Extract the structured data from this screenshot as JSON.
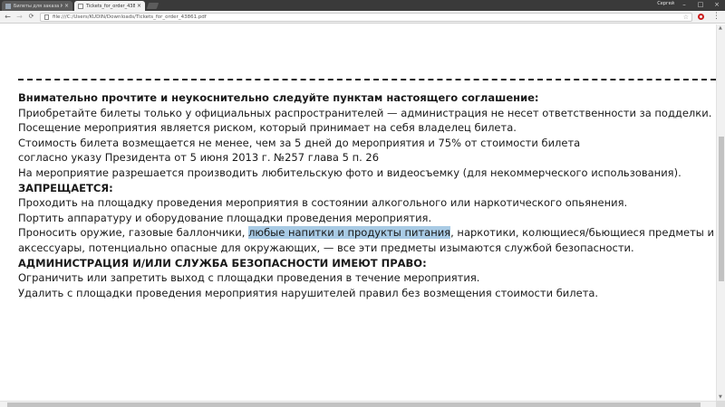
{
  "browser": {
    "tabs": [
      {
        "label": "Билеты для заказа №43861",
        "close": "×"
      },
      {
        "label": "Tickets_for_order_43861.pdf",
        "close": "×"
      }
    ],
    "user": "Сергей",
    "window_controls": {
      "minimize": "–",
      "maximize": "□",
      "close": "×"
    },
    "nav": {
      "back": "←",
      "forward": "→",
      "reload": "⟳"
    },
    "url": "file:///C:/Users/KUDIN/Downloads/Tickets_for_order_43861.pdf",
    "star": "☆",
    "menu": "⋮"
  },
  "document": {
    "heading": "Внимательно прочтите и неукоснительно следуйте пунктам настоящего соглашение:",
    "lines": [
      "Приобретайте билеты только у официальных распространителей — администрация не несет ответственности за подделки.",
      "Посещение мероприятия является риском, который принимает на себя владелец билета.",
      "Стоимость билета возмещается не менее, чем за 5 дней до мероприятия и 75% от стоимости билета",
      "согласно указу Президента от 5 июня 2013 г. №257 глава 5 п. 26",
      "На мероприятие разрешается производить любительскую фото и видеосъемку (для некоммерческого использования)."
    ],
    "forbidden_heading": "ЗАПРЕЩАЕТСЯ:",
    "forbidden_lines": [
      "Проходить на площадку проведения мероприятия в состоянии алкогольного или наркотического опьянения.",
      "Портить аппаратуру и оборудование площадки проведения мероприятия."
    ],
    "weapons_line": {
      "before": "Проносить оружие, газовые баллончики, ",
      "highlight": "любые напитки и продукты питания",
      "after": ", наркотики, колющиеся/бьющиеся предметы и"
    },
    "weapons_line2": "аксессуары, потенциально опасные для окружающих, — все эти предметы изымаются службой безопасности.",
    "admin_heading": "АДМИНИСТРАЦИЯ И/ИЛИ СЛУЖБА БЕЗОПАСНОСТИ ИМЕЮТ ПРАВО:",
    "admin_lines": [
      "Ограничить или запретить выход с площадки проведения в течение мероприятия.",
      "Удалить с площадки проведения мероприятия нарушителей правил без возмещения стоимости билета."
    ]
  },
  "colors": {
    "highlight": "#a9cbe5",
    "tabstrip": "#3a3a3a",
    "toolbar": "#f2f2f2"
  }
}
